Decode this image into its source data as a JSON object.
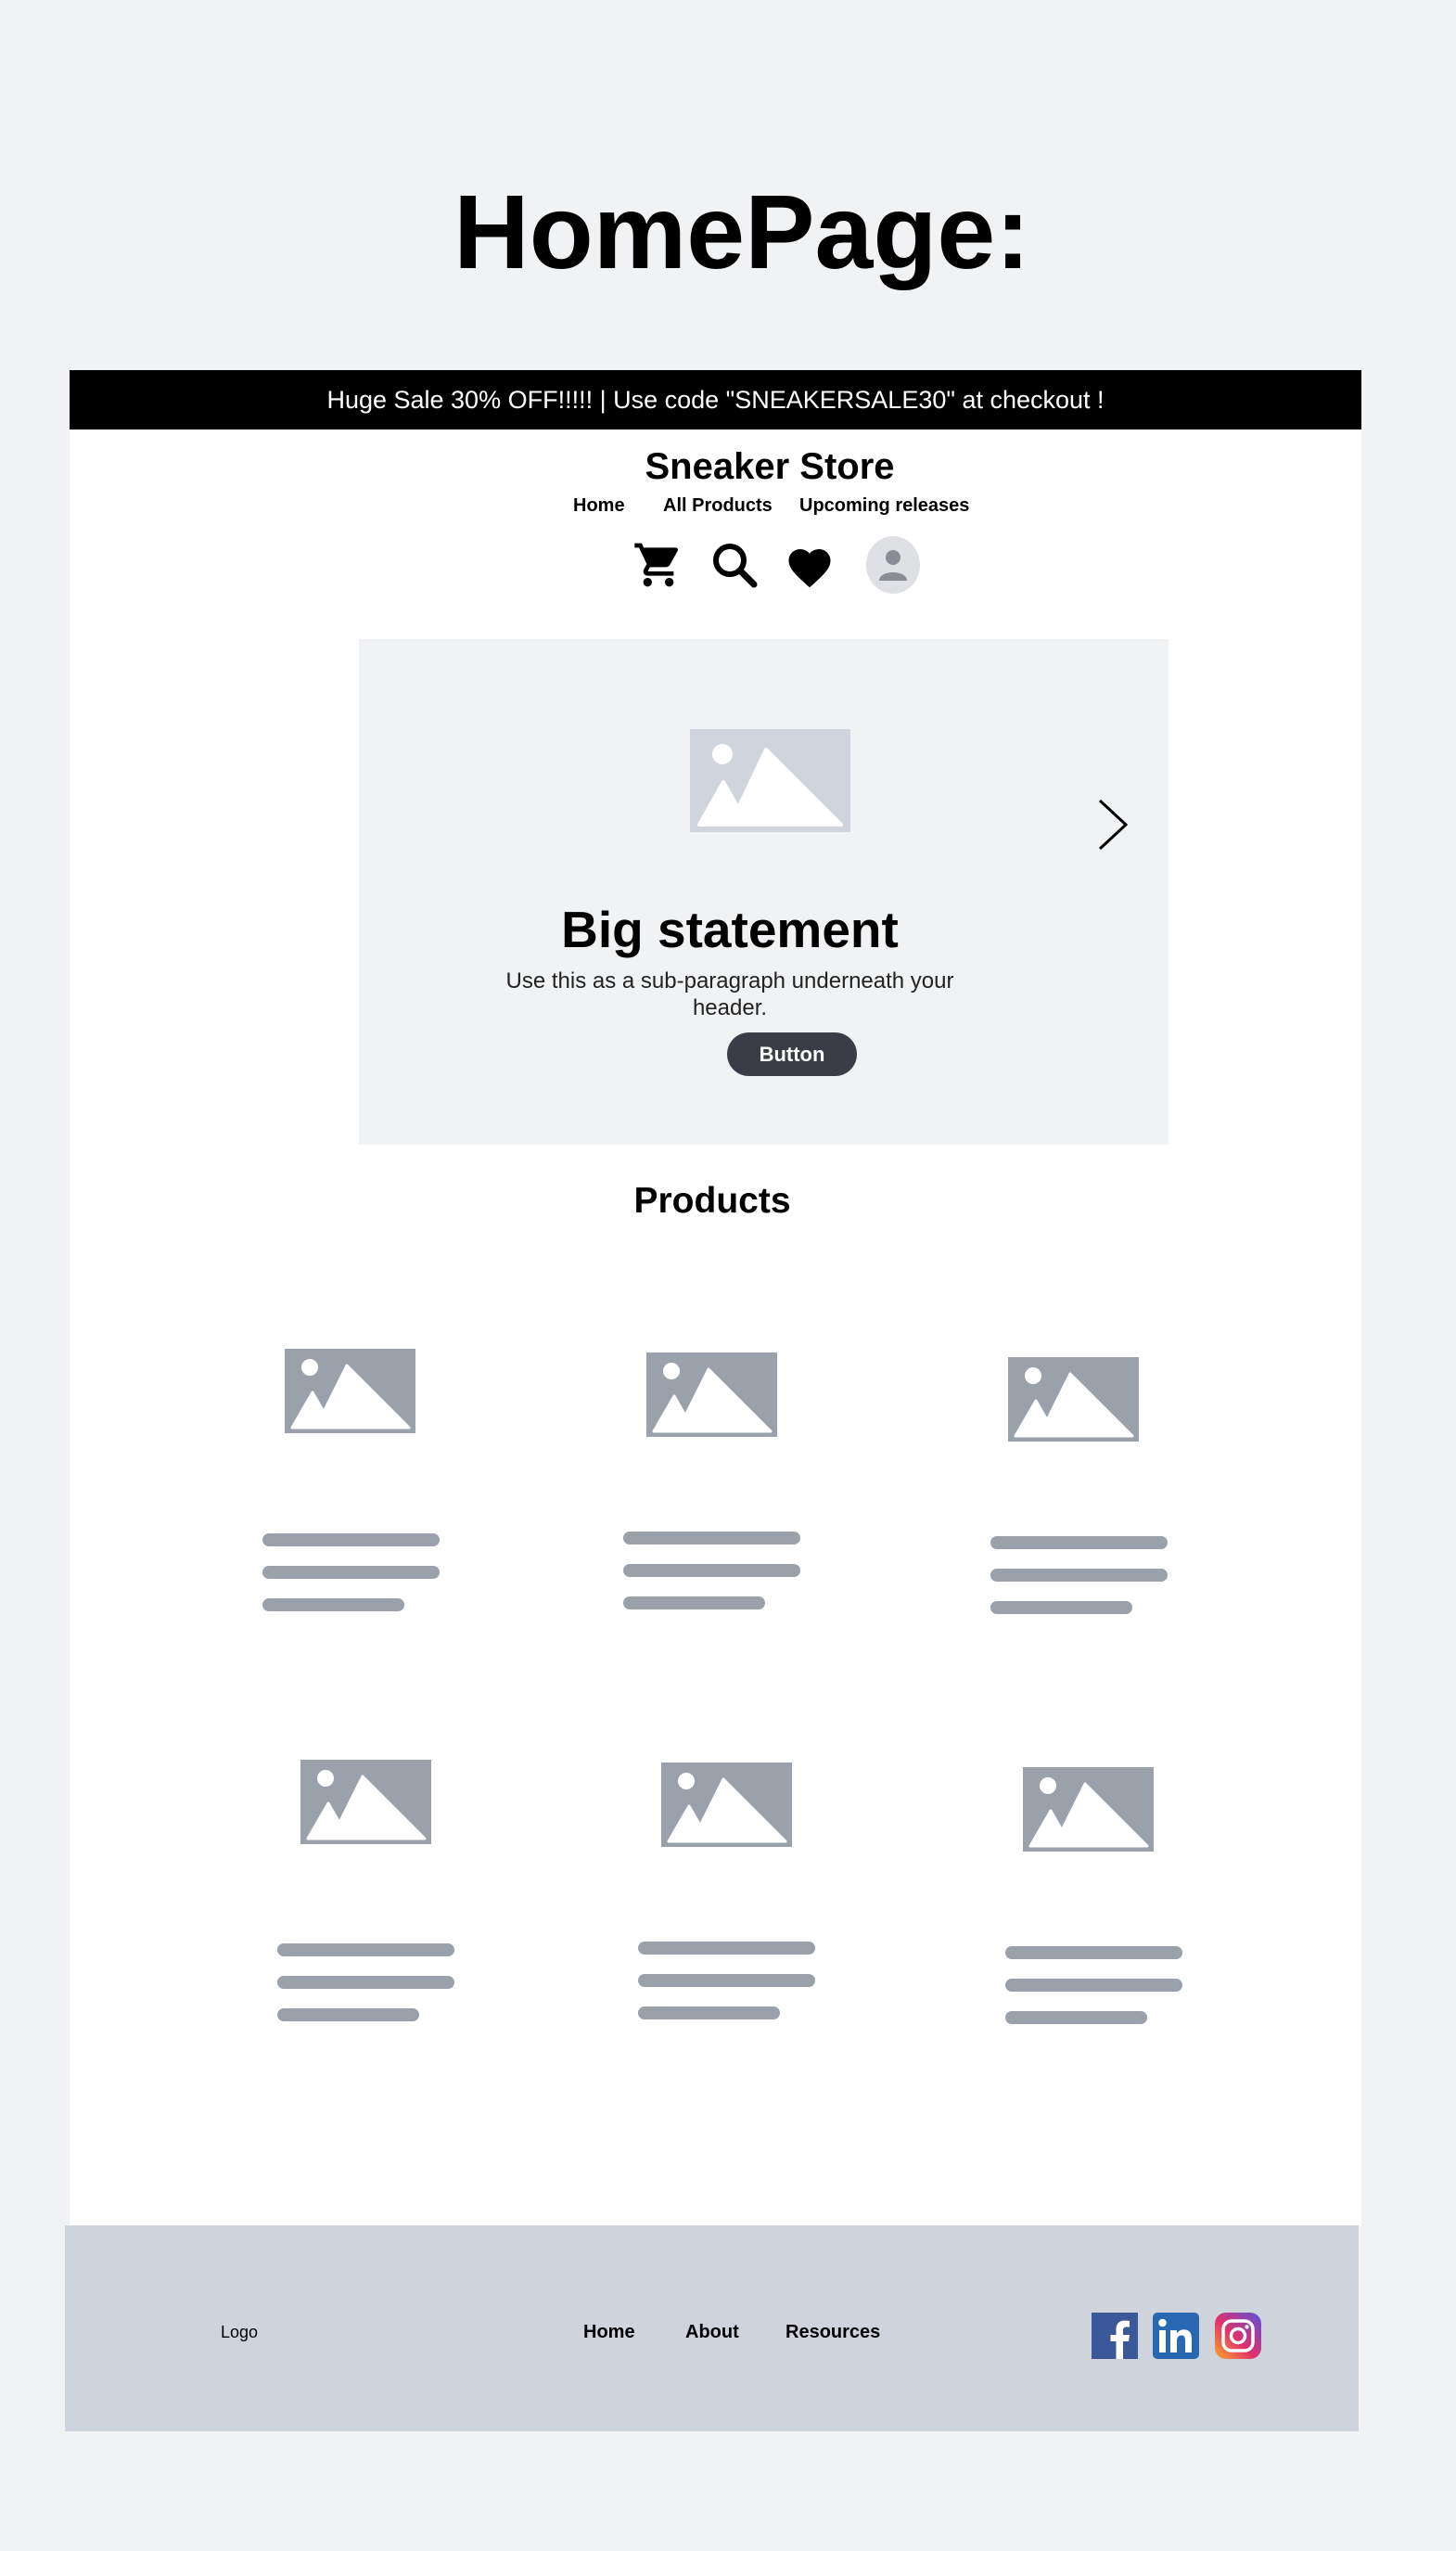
{
  "page": {
    "title": "HomePage:"
  },
  "banner": {
    "text": "Huge Sale 30% OFF!!!!! | Use code \"SNEAKERSALE30\" at checkout !"
  },
  "header": {
    "brand": "Sneaker Store",
    "nav": [
      {
        "label": "Home"
      },
      {
        "label": "All Products"
      },
      {
        "label": "Upcoming releases"
      }
    ],
    "icons": [
      "cart-icon",
      "search-icon",
      "heart-icon",
      "user-avatar-icon"
    ]
  },
  "hero": {
    "title": "Big statement",
    "subtitle": "Use this as a sub-paragraph underneath your header.",
    "button_label": "Button",
    "image_icon": "image-placeholder-icon",
    "arrow_icon": "chevron-right-icon"
  },
  "products": {
    "title": "Products",
    "count": 6,
    "image_icon": "image-placeholder-icon"
  },
  "footer": {
    "logo": "Logo",
    "links": [
      {
        "label": "Home"
      },
      {
        "label": "About"
      },
      {
        "label": "Resources"
      }
    ],
    "social": [
      "facebook-icon",
      "linkedin-icon",
      "instagram-icon"
    ]
  },
  "colors": {
    "background": "#f1f2f4",
    "banner": "#000000",
    "hero_bg": "#f1f2f4",
    "placeholder": "#9aa1ab",
    "button": "#3a3d45",
    "footer": "#cfd4dc",
    "facebook": "#3b5998",
    "linkedin": "#2867b2"
  }
}
